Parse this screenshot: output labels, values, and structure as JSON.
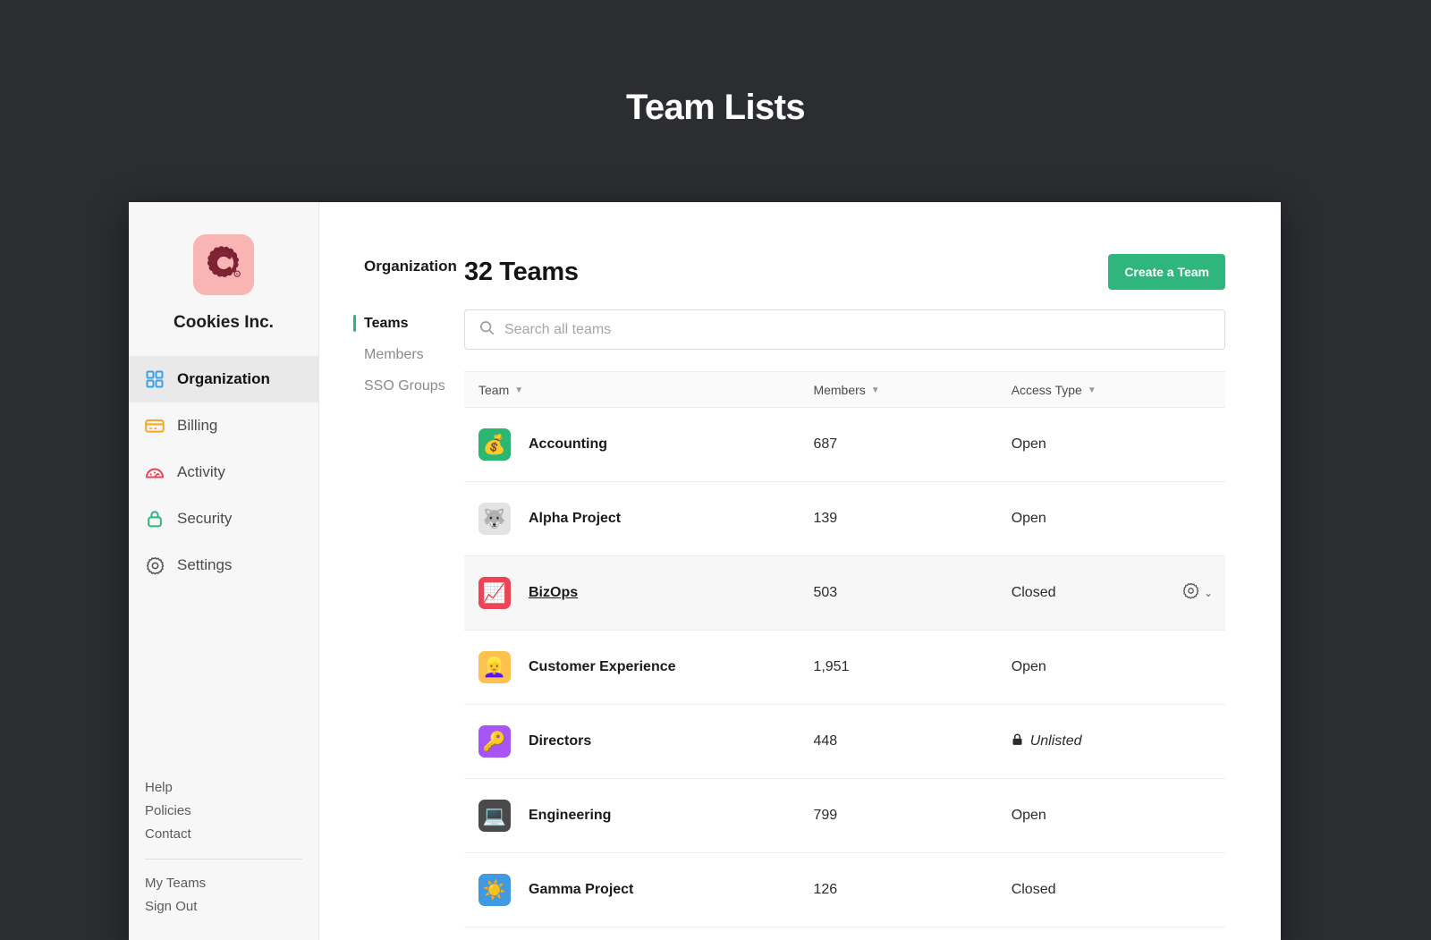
{
  "page": {
    "title": "Team Lists",
    "background_color": "#2b2d31",
    "accent_green": "#2eb67d"
  },
  "sidebar": {
    "org_name": "Cookies Inc.",
    "logo_icon": "cookie-c-logo",
    "logo_bg": "#f9b4b4",
    "nav": [
      {
        "label": "Organization",
        "icon": "grid-icon",
        "icon_color": "#3aa0e8",
        "active": true
      },
      {
        "label": "Billing",
        "icon": "credit-card-icon",
        "icon_color": "#f5a623",
        "active": false
      },
      {
        "label": "Activity",
        "icon": "gauge-icon",
        "icon_color": "#e8455a",
        "active": false
      },
      {
        "label": "Security",
        "icon": "lock-icon",
        "icon_color": "#2eb67d",
        "active": false
      },
      {
        "label": "Settings",
        "icon": "gear-icon",
        "icon_color": "#555555",
        "active": false
      }
    ],
    "footer_links": [
      "Help",
      "Policies",
      "Contact"
    ],
    "account_links": [
      "My Teams",
      "Sign Out"
    ]
  },
  "subnav": {
    "title": "Organization",
    "items": [
      {
        "label": "Teams",
        "active": true
      },
      {
        "label": "Members",
        "active": false
      },
      {
        "label": "SSO Groups",
        "active": false
      }
    ]
  },
  "main": {
    "heading": "32 Teams",
    "create_button": "Create a Team",
    "search": {
      "placeholder": "Search all teams",
      "value": "",
      "icon": "search-icon"
    },
    "table": {
      "columns": [
        {
          "label": "Team",
          "sortable": true
        },
        {
          "label": "Members",
          "sortable": true
        },
        {
          "label": "Access Type",
          "sortable": true
        }
      ],
      "rows": [
        {
          "name": "Accounting",
          "emoji": "💰",
          "tile_color": "#2bb673",
          "members": "687",
          "access": "Open",
          "unlisted": false,
          "hover": false
        },
        {
          "name": "Alpha Project",
          "emoji": "🐺",
          "tile_color": "#e3e3e3",
          "members": "139",
          "access": "Open",
          "unlisted": false,
          "hover": false
        },
        {
          "name": "BizOps",
          "emoji": "📈",
          "tile_color": "#ec4555",
          "members": "503",
          "access": "Closed",
          "unlisted": false,
          "hover": true
        },
        {
          "name": "Customer Experience",
          "emoji": "👱‍♀️",
          "tile_color": "#fcc14e",
          "members": "1,951",
          "access": "Open",
          "unlisted": false,
          "hover": false
        },
        {
          "name": "Directors",
          "emoji": "🔑",
          "tile_color": "#a855f7",
          "members": "448",
          "access": "Unlisted",
          "unlisted": true,
          "hover": false
        },
        {
          "name": "Engineering",
          "emoji": "💻",
          "tile_color": "#4a4a4a",
          "members": "799",
          "access": "Open",
          "unlisted": false,
          "hover": false
        },
        {
          "name": "Gamma Project",
          "emoji": "☀️",
          "tile_color": "#3f9ae0",
          "members": "126",
          "access": "Closed",
          "unlisted": false,
          "hover": false
        }
      ],
      "row_action_icons": [
        "gear-icon",
        "chevron-down-icon"
      ]
    }
  }
}
